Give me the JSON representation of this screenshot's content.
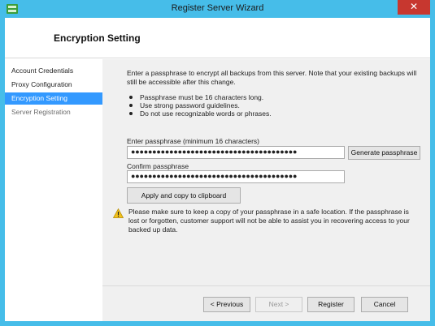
{
  "window": {
    "title": "Register Server Wizard",
    "close_glyph": "✕",
    "accent_color": "#46bde9"
  },
  "header": {
    "page_title": "Encryption Setting"
  },
  "sidebar": {
    "items": [
      {
        "label": "Account Credentials",
        "state": "normal"
      },
      {
        "label": "Proxy Configuration",
        "state": "normal"
      },
      {
        "label": "Encryption Setting",
        "state": "active"
      },
      {
        "label": "Server Registration",
        "state": "muted"
      }
    ]
  },
  "main": {
    "intro": "Enter a passphrase to encrypt all backups from this server. Note that your existing backups will still be accessible after this change.",
    "bullets": [
      "Passphrase must be 16 characters long.",
      "Use strong password guidelines.",
      "Do not use recognizable words or phrases."
    ],
    "passphrase_label": "Enter passphrase (minimum 16 characters)",
    "passphrase_value": "●●●●●●●●●●●●●●●●●●●●●●●●●●●●●●●●●●●●●●●",
    "generate_button": "Generate passphrase",
    "confirm_label": "Confirm passphrase",
    "confirm_value": "●●●●●●●●●●●●●●●●●●●●●●●●●●●●●●●●●●●●●●●",
    "apply_button": "Apply and copy to clipboard",
    "warning_text": "Please make sure to keep a copy of your passphrase in a safe location. If the passphrase is lost or forgotten, customer support will not be able to assist you in recovering access to your backed up data."
  },
  "footer": {
    "previous_button": "< Previous",
    "next_button": "Next >",
    "register_button": "Register",
    "cancel_button": "Cancel"
  },
  "icons": {
    "app": "server-app-icon",
    "warning": "warning-icon",
    "close": "close-icon"
  }
}
